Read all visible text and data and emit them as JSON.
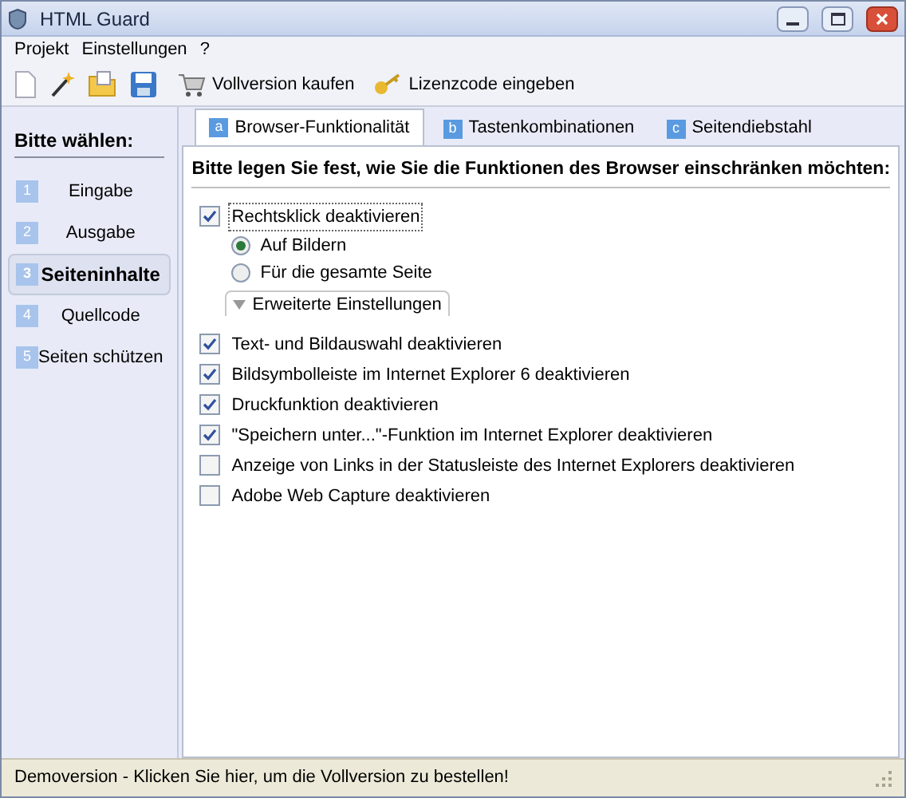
{
  "window": {
    "title": "HTML Guard"
  },
  "menu": [
    "Projekt",
    "Einstellungen",
    "?"
  ],
  "toolbar": {
    "buttons": [
      {
        "kind": "new"
      },
      {
        "kind": "wand"
      },
      {
        "kind": "open"
      },
      {
        "kind": "save"
      },
      {
        "kind": "cart",
        "label": "Vollversion kaufen"
      },
      {
        "kind": "key",
        "label": "Lizenzcode eingeben"
      }
    ]
  },
  "sidebar": {
    "title": "Bitte wählen:",
    "items": [
      {
        "number": "1",
        "label": "Eingabe",
        "selected": false
      },
      {
        "number": "2",
        "label": "Ausgabe",
        "selected": false
      },
      {
        "number": "3",
        "label": "Seiteninhalte",
        "selected": true
      },
      {
        "number": "4",
        "label": "Quellcode",
        "selected": false
      },
      {
        "number": "5",
        "label": "Seiten schützen",
        "selected": false
      }
    ]
  },
  "tabs": [
    {
      "letter": "a",
      "label": "Browser-Funktionalität",
      "selected": true
    },
    {
      "letter": "b",
      "label": "Tastenkombinationen",
      "selected": false
    },
    {
      "letter": "c",
      "label": "Seitendiebstahl",
      "selected": false
    }
  ],
  "heading": "Bitte legen Sie fest, wie Sie die Funktionen des Browser einschränken möchten:",
  "options": [
    {
      "label": "Rechtsklick deaktivieren",
      "checked": true,
      "focused": true,
      "children": [
        {
          "label": "Auf Bildern",
          "selected": true
        },
        {
          "label": "Für die gesamte Seite",
          "selected": false
        }
      ],
      "expander": {
        "label": "Erweiterte Einstellungen",
        "expanded": false
      }
    },
    {
      "label": "Text- und Bildauswahl deaktivieren",
      "checked": true,
      "focused": false
    },
    {
      "label": "Bildsymbolleiste im Internet Explorer 6 deaktivieren",
      "checked": true,
      "focused": false
    },
    {
      "label": "Druckfunktion deaktivieren",
      "checked": true,
      "focused": false
    },
    {
      "label": "\"Speichern unter...\"-Funktion im Internet Explorer deaktivieren",
      "checked": true,
      "focused": false
    },
    {
      "label": "Anzeige von Links in der Statusleiste des Internet Explorers deaktivieren",
      "checked": false,
      "focused": false
    },
    {
      "label": "Adobe Web Capture deaktivieren",
      "checked": false,
      "focused": false
    }
  ],
  "status_bar": "Demoversion - Klicken Sie hier, um die Vollversion zu bestellen!"
}
